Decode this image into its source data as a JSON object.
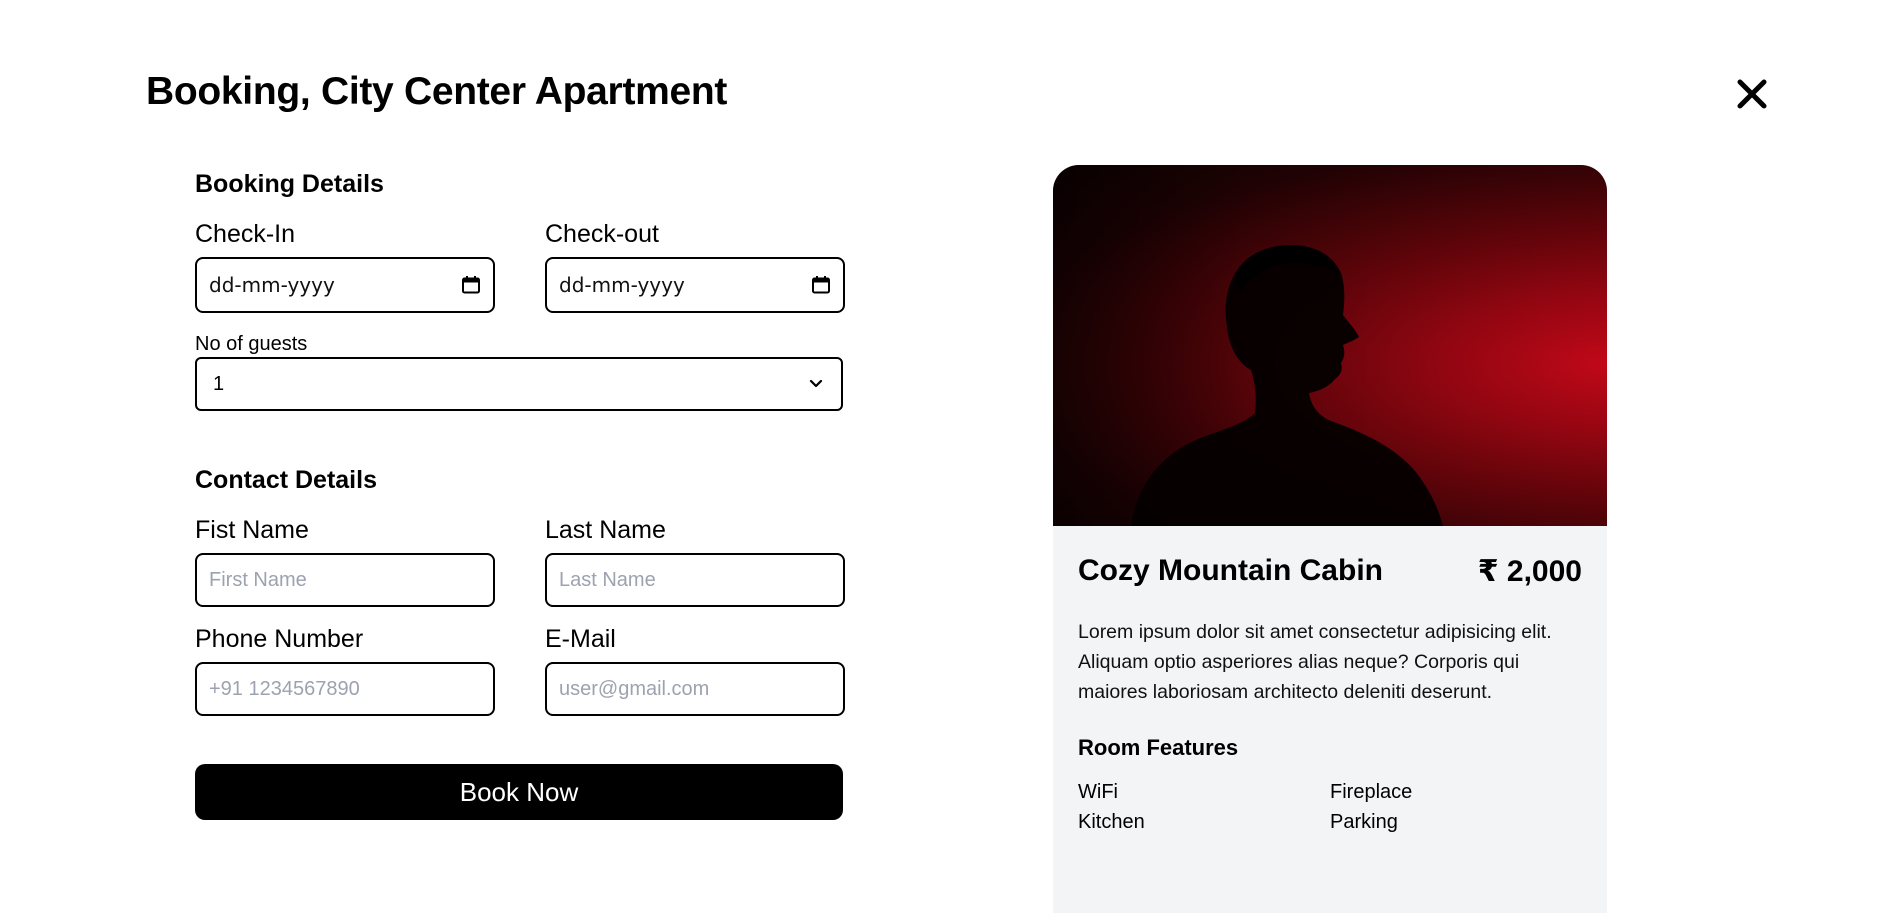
{
  "page_title": "Booking, City Center Apartment",
  "booking": {
    "heading": "Booking Details",
    "checkin_label": "Check-In",
    "checkin_value": "dd-mm-yyyy",
    "checkout_label": "Check-out",
    "checkout_value": "dd-mm-yyyy",
    "guests_label": "No of guests",
    "guests_value": "1"
  },
  "contact": {
    "heading": "Contact Details",
    "first_name_label": "Fist Name",
    "first_name_placeholder": "First Name",
    "last_name_label": "Last Name",
    "last_name_placeholder": "Last Name",
    "phone_label": "Phone Number",
    "phone_placeholder": "+91 1234567890",
    "email_label": "E-Mail",
    "email_placeholder": "user@gmail.com"
  },
  "book_button": "Book Now",
  "room": {
    "name": "Cozy Mountain Cabin",
    "price": "₹ 2,000",
    "description": "Lorem ipsum dolor sit amet consectetur adipisicing elit. Aliquam optio asperiores alias neque? Corporis qui maiores laboriosam architecto deleniti deserunt.",
    "features_heading": "Room Features",
    "features": [
      "WiFi",
      "Fireplace",
      "Kitchen",
      "Parking"
    ]
  },
  "icons": {
    "close": "close-icon",
    "calendar": "calendar-icon",
    "chevron": "chevron-down-icon"
  }
}
